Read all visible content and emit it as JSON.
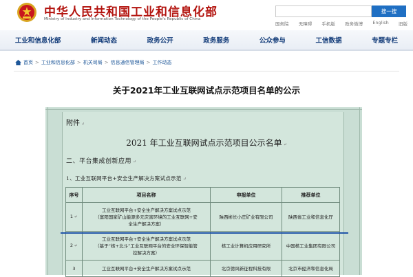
{
  "header": {
    "site_title": "中华人民共和国工业和信息化部",
    "site_subtitle": "Ministry of Industry and Information Technology of the People's Republic of China",
    "search_placeholder": "",
    "search_button": "搜一搜",
    "quick_links": [
      "国务院",
      "无障碍",
      "手机版",
      "政务微博",
      "English",
      "旧版"
    ]
  },
  "nav": {
    "items": [
      "工业和信息化部",
      "新闻动态",
      "政务公开",
      "政务服务",
      "公众参与",
      "工信数据",
      "专题专栏"
    ]
  },
  "breadcrumb": {
    "items": [
      "首页",
      "工业和信息化部",
      "机关司局",
      "信息通信管理局",
      "工作动态"
    ]
  },
  "article": {
    "title": "关于2021年工业互联网试点示范项目名单的公示"
  },
  "document": {
    "attachment_label": "附件",
    "doc_title": "2021 年工业互联网试点示范项目公示名单",
    "section_heading": "二、平台集成创新应用",
    "subsection_heading": "1、工业互联网平台+安全生产解决方案试点示范",
    "para_mark": "↵",
    "table": {
      "headers": [
        "序号",
        "项目名称",
        "申报单位",
        "推荐单位"
      ],
      "rows": [
        {
          "num": "1",
          "project_line1": "工业互联网平台+安全生产解决方案试点示范",
          "project_line2": "（富阳国家矿山能源多元灾害环境的工业互联网+安",
          "project_line3": "全生产解决方案）",
          "applicant": "陕西彬长小庄矿业有限公司",
          "recommender": "陕西省工业和信息化厅"
        },
        {
          "num": "2",
          "project_line1": "工业互联网平台+安全生产解决方案试点示范",
          "project_line2": "（基于“核+北斗”工业互联网平台的安全环保智能管",
          "project_line3": "控解决方案）",
          "applicant": "核工业计算机应用研究所",
          "recommender": "中国核工业集团有限公司"
        },
        {
          "num": "3",
          "project_line1": "工业互联网平台+安全生产解决方案试点示范",
          "applicant": "北京德风新征程科技有限",
          "recommender": "北京市经济和信息化局"
        }
      ]
    }
  }
}
